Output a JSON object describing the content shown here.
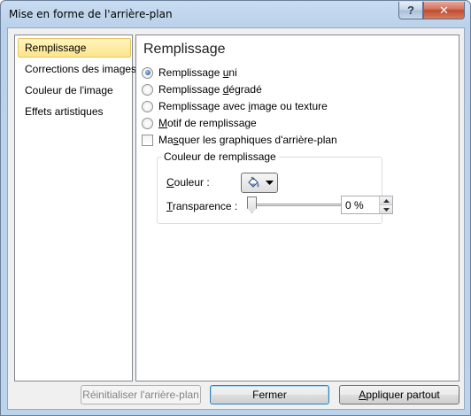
{
  "window": {
    "title": "Mise en forme de l'arrière-plan",
    "help_glyph": "?",
    "close_glyph": "✕"
  },
  "nav": {
    "items": [
      {
        "label": "Remplissage",
        "selected": true
      },
      {
        "label": "Corrections des images",
        "selected": false
      },
      {
        "label": "Couleur de l'image",
        "selected": false
      },
      {
        "label": "Effets artistiques",
        "selected": false
      }
    ]
  },
  "content": {
    "title": "Remplissage",
    "options": {
      "solid_pre": "Remplissage ",
      "solid_key": "u",
      "solid_post": "ni",
      "gradient_pre": "Remplissage ",
      "gradient_key": "d",
      "gradient_post": "égradé",
      "picture_pre": "Remplissage avec ",
      "picture_key": "i",
      "picture_post": "mage ou texture",
      "pattern_pre": "",
      "pattern_key": "M",
      "pattern_post": "otif de remplissage",
      "selected": "solid"
    },
    "hide_graphics": {
      "pre": "Ma",
      "key": "s",
      "post": "quer les graphiques d'arrière-plan",
      "checked": false
    },
    "fill_color_group": {
      "legend": "Couleur de remplissage",
      "color_label_pre": "",
      "color_label_key": "C",
      "color_label_post": "ouleur :",
      "transparency_label_pre": "",
      "transparency_label_key": "T",
      "transparency_label_post": "ransparence :",
      "transparency_value": "0 %",
      "transparency_fraction": 0,
      "paint_bucket_icon": "paint-bucket-icon",
      "dropdown_icon": "chevron-down-icon"
    }
  },
  "footer": {
    "reset_label": "Réinitialiser l'arrière-plan",
    "close_label": "Fermer",
    "apply_all_pre": "",
    "apply_all_key": "A",
    "apply_all_post": "ppliquer partout"
  },
  "colors": {
    "selection_bg": "#fde58a",
    "selection_border": "#e5c365",
    "title_bar": "#bcd3ec",
    "close_button": "#c04c30"
  }
}
